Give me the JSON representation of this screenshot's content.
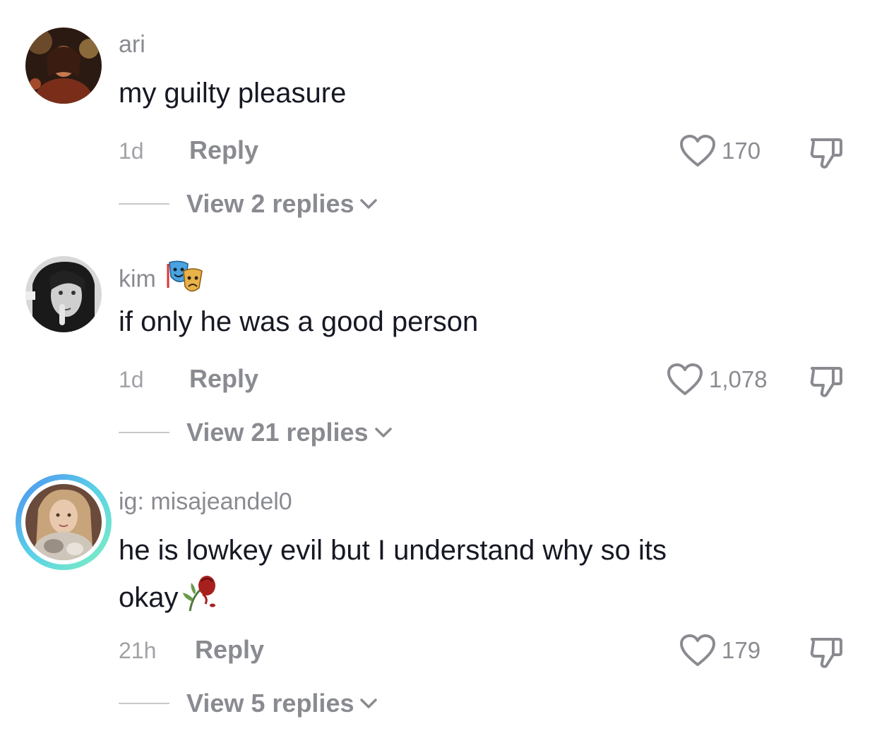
{
  "comments": [
    {
      "username": "ari",
      "text": "my guilty pleasure",
      "time": "1d",
      "reply_label": "Reply",
      "likes": "170",
      "view_replies": "View 2 replies"
    },
    {
      "username": "kim",
      "text": "if only he was a good person",
      "time": "1d",
      "reply_label": "Reply",
      "likes": "1,078",
      "view_replies": "View 21 replies"
    },
    {
      "username": "ig: misajeandel0",
      "text_line1": "he is lowkey evil but I understand why so its",
      "text_line2": "okay",
      "time": "21h",
      "reply_label": "Reply",
      "likes": "179",
      "view_replies": "View 5 replies"
    }
  ],
  "icons": {
    "like": "heart-outline-icon",
    "dislike": "thumbs-down-icon",
    "expand": "chevron-down-icon",
    "kim_emoji": "performing-arts-emoji",
    "okay_emoji": "wilted-rose-emoji"
  },
  "colors": {
    "primary_text": "#161823",
    "secondary_text": "#8a8b91",
    "story_ring": "#5ad2e6"
  }
}
